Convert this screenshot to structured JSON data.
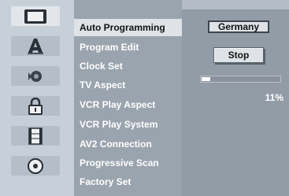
{
  "sidebar": {
    "icons": [
      {
        "name": "tv-screen-icon",
        "selected": true
      },
      {
        "name": "font-letter-icon",
        "selected": false
      },
      {
        "name": "audio-speaker-icon",
        "selected": false
      },
      {
        "name": "padlock-icon",
        "selected": false
      },
      {
        "name": "film-strip-icon",
        "selected": false
      },
      {
        "name": "disc-icon",
        "selected": false
      }
    ]
  },
  "menu": {
    "items": [
      {
        "label": "Auto Programming",
        "selected": true
      },
      {
        "label": "Program Edit"
      },
      {
        "label": "Clock Set"
      },
      {
        "label": "TV Aspect"
      },
      {
        "label": "VCR Play Aspect"
      },
      {
        "label": "VCR Play System"
      },
      {
        "label": "AV2 Connection"
      },
      {
        "label": "Progressive Scan"
      },
      {
        "label": "Factory Set"
      }
    ]
  },
  "panel": {
    "country": "Germany",
    "stop_label": "Stop",
    "progress_value": 0.11,
    "progress_text": "11%"
  },
  "colors": {
    "menu_bg": "#9aa4ae",
    "panel_bg": "#929ca7",
    "selected_bg": "#dfe3e8",
    "text_white": "#ffffff",
    "text_dark": "#111111"
  }
}
